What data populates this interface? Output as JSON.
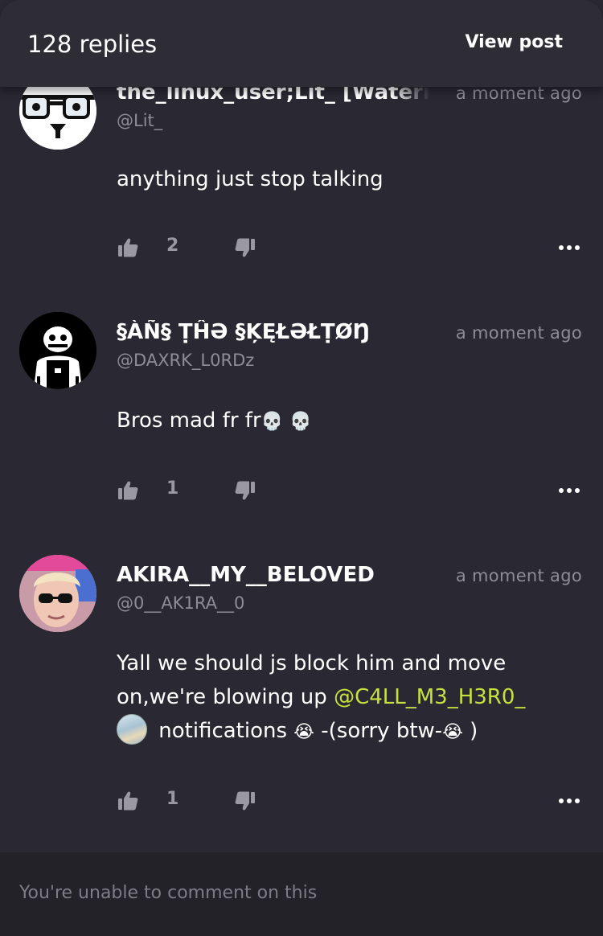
{
  "header": {
    "title": "128 replies",
    "action_label": "View post"
  },
  "comments": [
    {
      "name": "the_linux_user;Lit_ [Watern",
      "handle": "@Lit_",
      "time": "a moment ago",
      "text": "anything just stop talking",
      "likes": "2"
    },
    {
      "name": "§ÀÑ§ ṬĤƏ §ĶĘŁƏŁṬØŊ",
      "handle": "@DAXRK_L0RDz",
      "time": "a moment ago",
      "text": "Bros mad fr fr",
      "emoji1": "💀",
      "emoji2": "💀",
      "likes": "1"
    },
    {
      "name": "AKIRA__MY__BELOVED",
      "handle": "@0__AK1RA__0",
      "time": "a moment ago",
      "text_part1": "Yall we should js block him and move on,we're blowing up ",
      "mention": "@C4LL_M3_H3R0_",
      "text_part2": " notifications ",
      "emoji1": "😭",
      "text_part3": " -(sorry btw-",
      "emoji2": "😭",
      "text_part4": " )",
      "likes": "1"
    }
  ],
  "footer": {
    "notice": "You're unable to comment on this"
  },
  "colors": {
    "background": "#2a2832",
    "header": "#2e2d36",
    "footer": "#232228",
    "muted_text": "#8e8c97",
    "mention": "#c8e13e"
  },
  "icons": [
    "thumbs-up-icon",
    "thumbs-down-icon",
    "more-options-icon"
  ]
}
